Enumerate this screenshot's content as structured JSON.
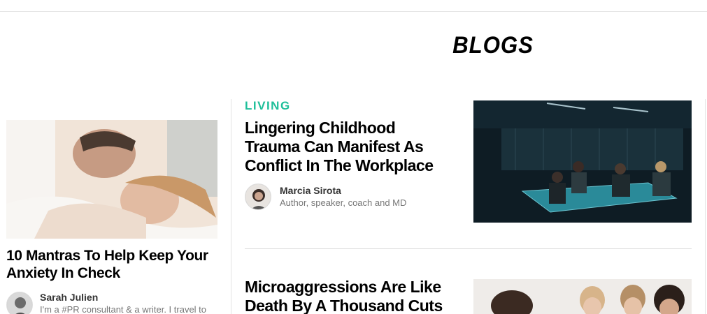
{
  "section": {
    "title": "BLOGS"
  },
  "left_article": {
    "headline": "10 Mantras To Help Keep Your Anxiety In Check",
    "author": {
      "name": "Sarah Julien",
      "bio": "I'm a #PR consultant & a writer. I travel to"
    }
  },
  "articles": [
    {
      "category": "LIVING",
      "headline": "Lingering Childhood Trauma Can Manifest As Conflict In The Workplace",
      "author": {
        "name": "Marcia Sirota",
        "bio": "Author, speaker, coach and MD"
      }
    },
    {
      "headline": "Microaggressions Are Like Death By A Thousand Cuts"
    }
  ],
  "colors": {
    "category_accent": "#1fbf9a"
  }
}
